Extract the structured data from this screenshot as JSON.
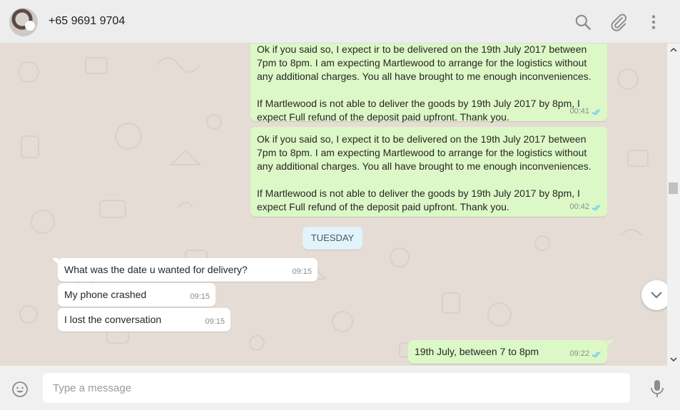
{
  "header": {
    "contact_name": "+65 9691 9704",
    "icons": [
      "search-icon",
      "attach-icon",
      "menu-icon"
    ]
  },
  "date_separator": "TUESDAY",
  "messages": [
    {
      "direction": "out",
      "text": "Ok if you said so, I expect ir to be delivered on the 19th July 2017 between\n7pm to 8pm. I am expecting Martlewood to arrange for the logistics without\nany additional charges. You all have brought to me enough inconveniences.\n\nIf Martlewood is not able to deliver the goods by 19th July 2017 by 8pm, I\nexpect Full refund of the deposit paid upfront. Thank you.",
      "time": "00:41",
      "status": "read"
    },
    {
      "direction": "out",
      "text": "Ok if you said so, I expect it to be delivered on the 19th July 2017 between\n7pm to 8pm. I am expecting Martlewood to arrange for the logistics without\nany additional charges. You all have brought to me enough inconveniences.\n\nIf Martlewood is not able to deliver the goods by 19th July 2017 by 8pm, I\nexpect Full refund of the deposit paid upfront. Thank you.",
      "time": "00:42",
      "status": "read"
    },
    {
      "direction": "in",
      "text": "What was the date u wanted for delivery?",
      "time": "09:15"
    },
    {
      "direction": "in",
      "text": "My phone crashed",
      "time": "09:15"
    },
    {
      "direction": "in",
      "text": "I lost the conversation",
      "time": "09:15"
    },
    {
      "direction": "out",
      "text": "19th July, between 7 to 8pm",
      "time": "09:22",
      "status": "read"
    }
  ],
  "composer": {
    "placeholder": "Type a message",
    "value": ""
  },
  "colors": {
    "outgoing_bubble": "#dcf8c6",
    "incoming_bubble": "#ffffff",
    "chat_background": "#e5ddd5",
    "read_tick": "#4fc3f7",
    "date_badge": "#e1f3fb"
  }
}
